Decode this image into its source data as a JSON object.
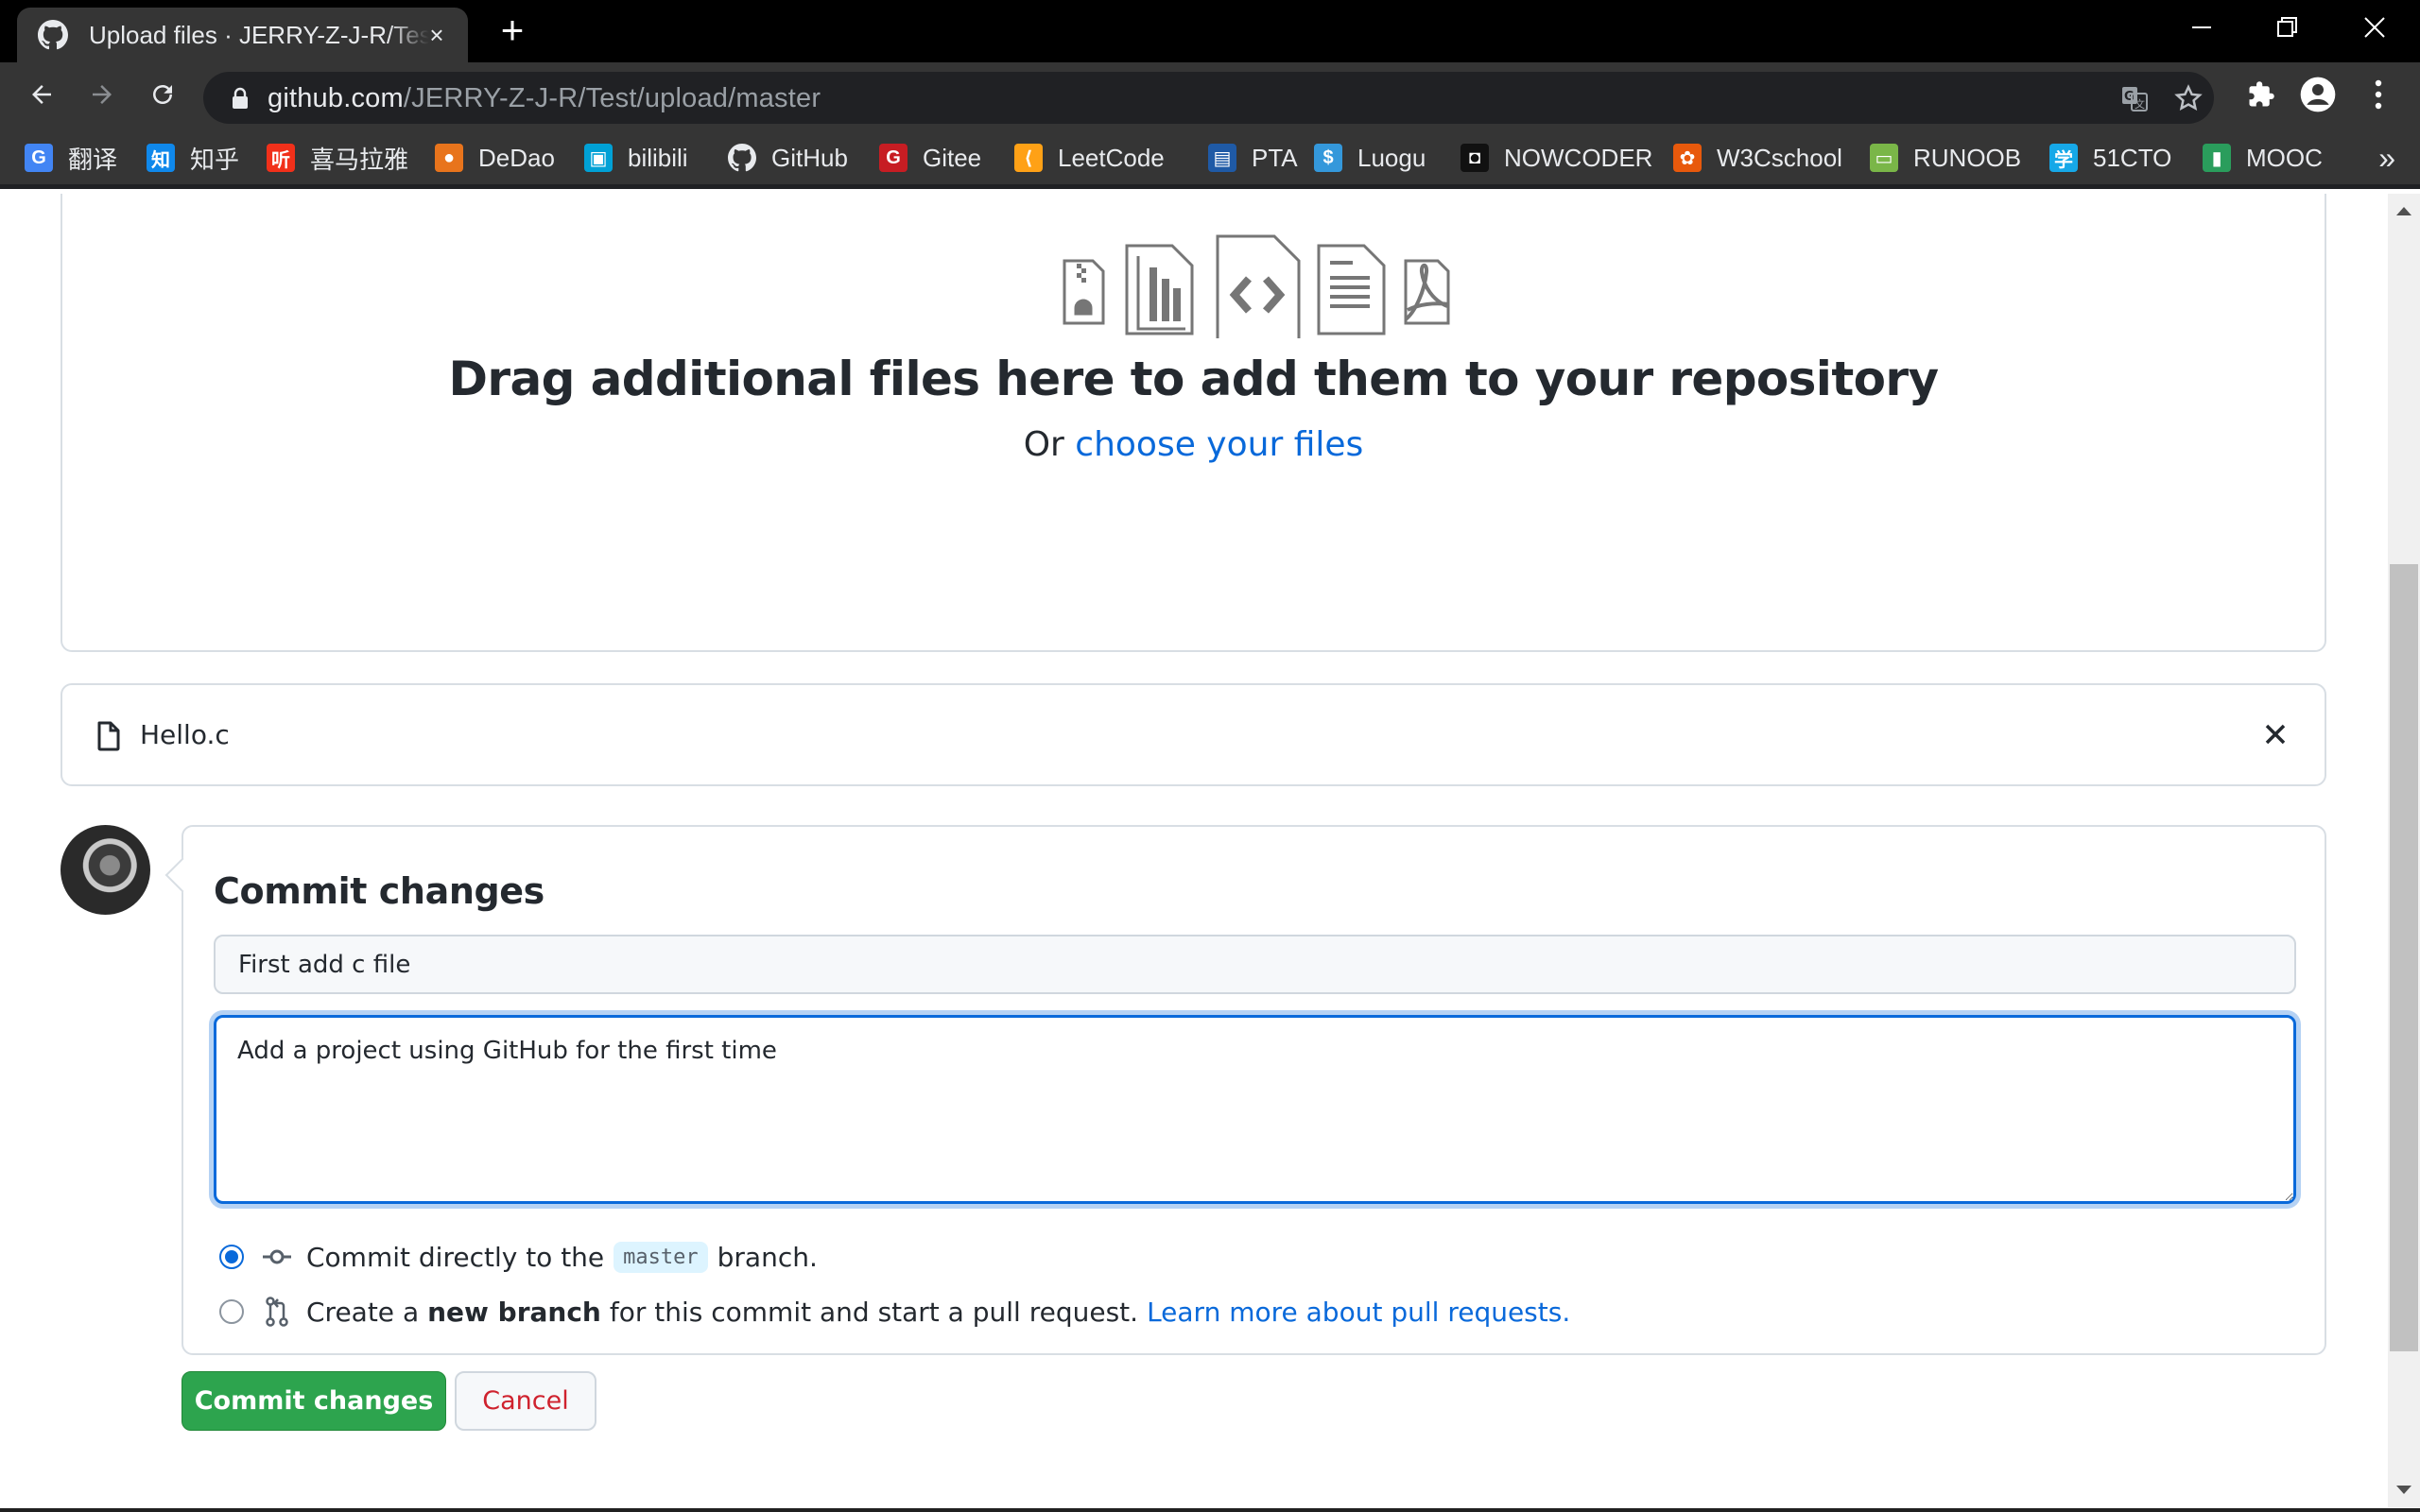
{
  "browser": {
    "tab_title": "Upload files · JERRY-Z-J-R/Test",
    "tab_close": "×",
    "new_tab": "+",
    "url_host": "github.com",
    "url_path": "/JERRY-Z-J-R/Test/upload/master",
    "bookmarks": [
      {
        "label": "翻译",
        "icon": "google-translate-icon",
        "color": "#4285f4",
        "glyph": "G"
      },
      {
        "label": "知乎",
        "icon": "zhihu-icon",
        "color": "#0f88eb",
        "glyph": "知"
      },
      {
        "label": "喜马拉雅",
        "icon": "ximalaya-icon",
        "color": "#f1301a",
        "glyph": "听"
      },
      {
        "label": "DeDao",
        "icon": "dedao-icon",
        "color": "#e8741c",
        "glyph": "●"
      },
      {
        "label": "bilibili",
        "icon": "bilibili-icon",
        "color": "#00a1d6",
        "glyph": "▣"
      },
      {
        "label": "GitHub",
        "icon": "github-icon",
        "color": "#ffffff",
        "glyph": ""
      },
      {
        "label": "Gitee",
        "icon": "gitee-icon",
        "color": "#c71d23",
        "glyph": "G"
      },
      {
        "label": "LeetCode",
        "icon": "leetcode-icon",
        "color": "#ffa116",
        "glyph": "⟨"
      },
      {
        "label": "PTA",
        "icon": "pta-icon",
        "color": "#1f5aa6",
        "glyph": "▤"
      },
      {
        "label": "Luogu",
        "icon": "luogu-icon",
        "color": "#3498db",
        "glyph": "$"
      },
      {
        "label": "NOWCODER",
        "icon": "nowcoder-icon",
        "color": "#111111",
        "glyph": "◘"
      },
      {
        "label": "W3Cschool",
        "icon": "w3cschool-icon",
        "color": "#e8590c",
        "glyph": "✿"
      },
      {
        "label": "RUNOOB",
        "icon": "runoob-icon",
        "color": "#7ab648",
        "glyph": "▭"
      },
      {
        "label": "51CTO",
        "icon": "51cto-icon",
        "color": "#16a8e8",
        "glyph": "学"
      },
      {
        "label": "MOOC",
        "icon": "mooc-icon",
        "color": "#2a9d5c",
        "glyph": "▮"
      }
    ],
    "bookmarks_more": "»"
  },
  "dropzone": {
    "title": "Drag additional files here to add them to your repository",
    "sub_prefix": "Or ",
    "sub_link": "choose your files"
  },
  "files": [
    {
      "name": "Hello.c"
    }
  ],
  "commit": {
    "heading": "Commit changes",
    "summary_value": "First add c file",
    "description_value": "Add a project using GitHub for the first time",
    "option_direct": {
      "prefix": "Commit directly to the",
      "branch": "master",
      "suffix": "branch.",
      "checked": true
    },
    "option_new_branch": {
      "prefix": "Create a",
      "bold": "new branch",
      "suffix": "for this commit and start a pull request.",
      "link": "Learn more about pull requests.",
      "checked": false
    },
    "submit_label": "Commit changes",
    "cancel_label": "Cancel"
  },
  "colors": {
    "primary_green": "#2da44e",
    "link_blue": "#0969da",
    "danger_red": "#cf222e"
  }
}
